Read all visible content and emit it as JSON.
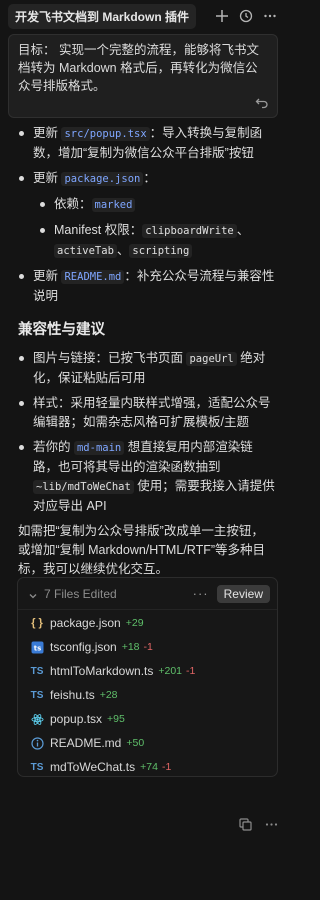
{
  "header": {
    "title": "开发飞书文档到 Markdown 插件",
    "icons": [
      "plus-icon",
      "history-icon",
      "more-icon"
    ]
  },
  "prompt": {
    "text": "目标： 实现一个完整的流程，能够将飞书文档转为 Markdown 格式后，再转化为微信公众号排版格式。"
  },
  "bullets1": [
    {
      "a": "更新 ",
      "code": "src/popup.tsx",
      "b": "：导入转换与复制函数，增加“复制为微信公众平台排版”按钮"
    },
    {
      "a": "更新 ",
      "code": "package.json",
      "b": "："
    },
    {
      "sub_dep_label": "依赖：",
      "sub_dep_code": "marked"
    },
    {
      "sub_perm_label": "Manifest 权限：",
      "sub_perm_codes": [
        "clipboardWrite",
        "activeTab",
        "scripting"
      ]
    },
    {
      "a": "更新 ",
      "code": "README.md",
      "b": "：补充公众号流程与兼容性说明"
    }
  ],
  "section_title": "兼容性与建议",
  "bullets2": [
    {
      "a": "图片与链接：已按飞书页面 ",
      "code": "pageUrl",
      "b": " 绝对化，保证粘贴后可用"
    },
    {
      "a": "样式：采用轻量内联样式增强，适配公众号编辑器；如需杂志风格可扩展模板/主题"
    },
    {
      "a": "若你的 ",
      "code": "md-main",
      "b": " 想直接复用内部渲染链路，也可将其导出的渲染函数抽到 ",
      "code2": "~lib/mdToWeChat",
      "c": " 使用；需要我接入请提供对应导出 API"
    }
  ],
  "closing": "如需把“复制为公众号排版”改成单一主按钮，或增加“复制 Markdown/HTML/RTF”等多种目标，我可以继续优化交互。",
  "files": {
    "count_label": "7 Files Edited",
    "review_label": "Review",
    "items": [
      {
        "name": "package.json",
        "add": "+29",
        "del": "",
        "icon": "json-icon"
      },
      {
        "name": "tsconfig.json",
        "add": "+18",
        "del": "-1",
        "icon": "tsconfig-icon"
      },
      {
        "name": "htmlToMarkdown.ts",
        "add": "+201",
        "del": "-1",
        "icon": "ts-icon"
      },
      {
        "name": "feishu.ts",
        "add": "+28",
        "del": "",
        "icon": "ts-icon"
      },
      {
        "name": "popup.tsx",
        "add": "+95",
        "del": "",
        "icon": "react-icon"
      },
      {
        "name": "README.md",
        "add": "+50",
        "del": "",
        "icon": "info-icon"
      },
      {
        "name": "mdToWeChat.ts",
        "add": "+74",
        "del": "-1",
        "icon": "ts-icon"
      }
    ]
  },
  "colors": {
    "background": "#141414",
    "code_blue": "#7fa6ff",
    "add_green": "#5fbf6a",
    "del_red": "#e06565"
  }
}
